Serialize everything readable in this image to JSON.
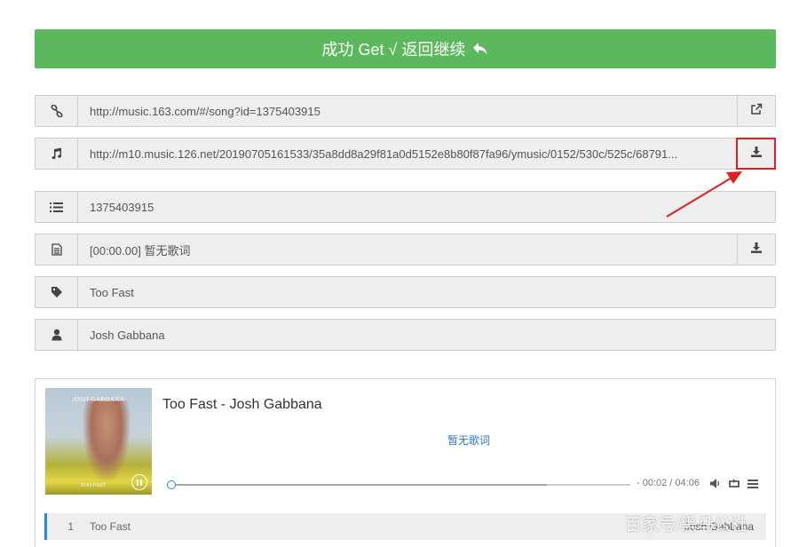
{
  "banner": {
    "label": "成功 Get √ 返回继续",
    "icon": "reply-arrow-icon",
    "color": "#5cb85c"
  },
  "rows": [
    {
      "icon": "link-icon",
      "value": "http://music.163.com/#/song?id=1375403915",
      "action_icon": "external-link-icon"
    },
    {
      "icon": "music-note-icon",
      "value": "http://m10.music.126.net/20190705161533/35a8dd8a29f81a0d5152e8b80f87fa96/ymusic/0152/530c/525c/68791...",
      "action_icon": "download-icon"
    },
    {
      "icon": "list-icon",
      "value": "1375403915"
    },
    {
      "icon": "document-icon",
      "value": "[00:00.00] 暂无歌词",
      "action_icon": "download-icon"
    },
    {
      "icon": "tag-icon",
      "value": "Too Fast"
    },
    {
      "icon": "user-icon",
      "value": "Josh Gabbana"
    }
  ],
  "player": {
    "cover_text": "JOSH GABBANA",
    "cover_subtext": "TOO FAST",
    "title": "Too Fast - Josh Gabbana",
    "lyric": "暂无歌词",
    "progress": 0.008,
    "loaded": 0.82,
    "time": "- 00:02 / 04:06",
    "accent": "#2a8ad4"
  },
  "playlist": [
    {
      "number": "1",
      "title": "Too Fast",
      "artist": "Josh Gabbana"
    }
  ],
  "annotation": {
    "color": "#e02020"
  },
  "watermark": "百家号/黑马公社"
}
